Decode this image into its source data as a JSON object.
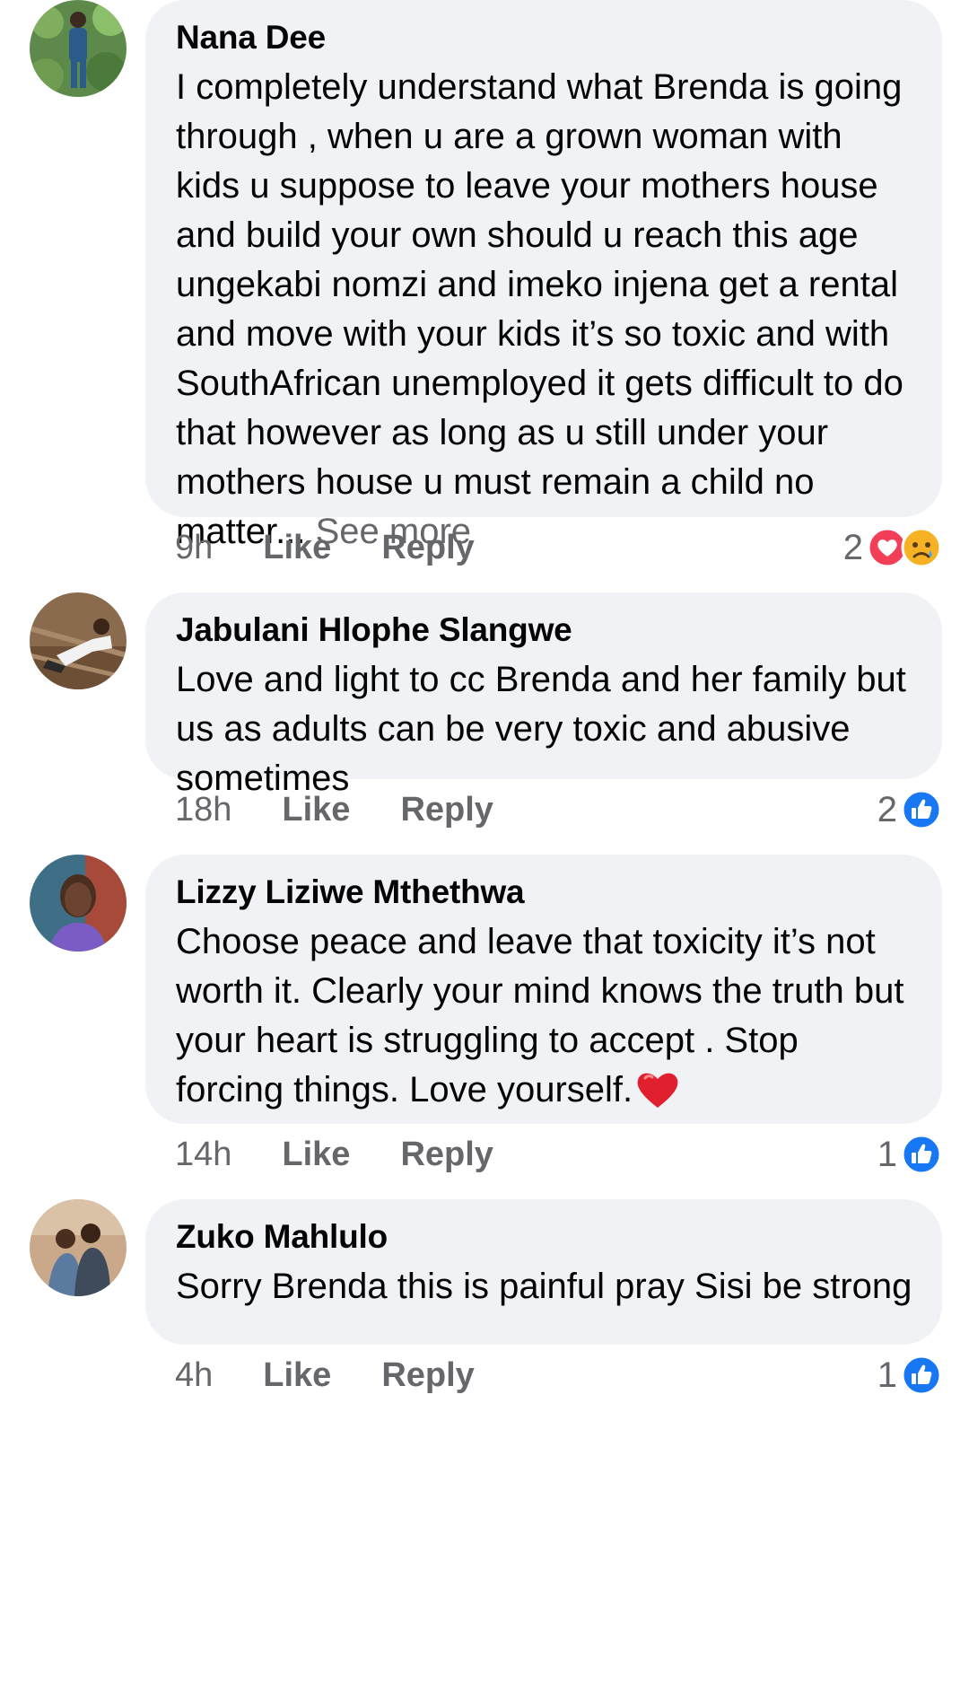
{
  "colors": {
    "bubble_bg": "#f0f2f5",
    "meta_text": "#65676b",
    "like_blue": "#1877f2",
    "love_red": "#f33e58",
    "sad_yellow": "#f7b125"
  },
  "comments": [
    {
      "author": "Nana Dee",
      "text": "I completely understand what Brenda is going through , when u are a grown woman with kids u suppose to leave your mothers house and build your own should u reach this age ungekabi nomzi and imeko injena get a rental and move with your kids it’s so toxic and with SouthAfrican unemployed it gets difficult to do that however as long as u still under your mothers house u must remain a child no matter...",
      "see_more": "See more",
      "time": "9h",
      "like": "Like",
      "reply": "Reply",
      "reaction_count": "2",
      "reaction_icons": [
        "heart-icon",
        "sad-face-icon"
      ]
    },
    {
      "author": "Jabulani Hlophe Slangwe",
      "text": "Love and light to cc Brenda and her family but us as adults can be very toxic and abusive sometimes",
      "time": "18h",
      "like": "Like",
      "reply": "Reply",
      "reaction_count": "2",
      "reaction_icons": [
        "thumbs-up-icon"
      ]
    },
    {
      "author": "Lizzy Liziwe Mthethwa",
      "text": "Choose peace and leave that toxicity it’s not worth it. Clearly your mind knows the truth but your heart is struggling to accept . Stop forcing things. Love yourself.",
      "emoji": "red-heart-emoji",
      "time": "14h",
      "like": "Like",
      "reply": "Reply",
      "reaction_count": "1",
      "reaction_icons": [
        "thumbs-up-icon"
      ]
    },
    {
      "author": "Zuko Mahlulo",
      "text": "Sorry Brenda this is painful pray Sisi be strong",
      "time": "4h",
      "like": "Like",
      "reply": "Reply",
      "reaction_count": "1",
      "reaction_icons": [
        "thumbs-up-icon"
      ]
    }
  ]
}
